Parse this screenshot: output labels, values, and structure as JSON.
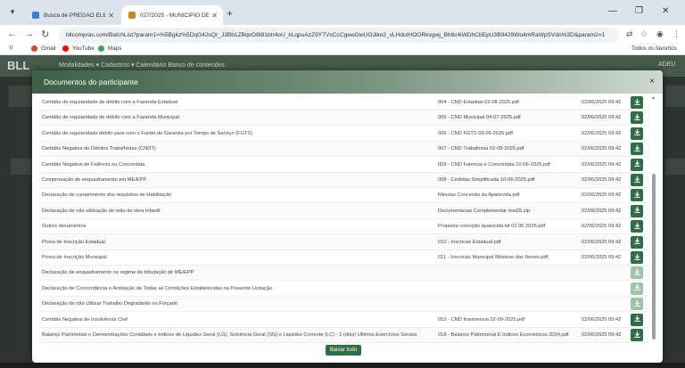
{
  "browser": {
    "tabs": [
      {
        "title": "Busca de PREGÃO ELETRÔNICO",
        "fav_color": "#3b7bd6"
      },
      {
        "title": "027/2025 - MUNICIPIO DE CO",
        "fav_color": "#c98a17"
      }
    ],
    "new_tab": "+",
    "url": "bllcompras.com/BatchList?param1=%5Bgkz%5DqG42sQr_J3Bb1ZBqvG6t81btr4oU_kLqpuAzZ9YTVxCcCgewGwUOJikn2_vLHdutHOORkvgwj_Bh8c4iWDhCbEpU3B9429Wo4mRaWpSVdo%3D&param2=1",
    "bookmarks": [
      {
        "label": "Gmail",
        "color": "#d44638"
      },
      {
        "label": "YouTube",
        "color": "#ff0000"
      },
      {
        "label": "Maps",
        "color": "#34a853"
      }
    ],
    "all_bookmarks": "Todos os favoritos"
  },
  "background": {
    "logo": "BLL",
    "menu": "Modalidades ▾   Cadastros ▾   Calendário   Banco de conteúdos",
    "right_text": "ADEU"
  },
  "modal": {
    "title": "Documentos do participante",
    "close": "×",
    "close_button": "Baixar todo",
    "rows": [
      {
        "name": "Certidão de regularidade de débito com a Fazenda Estadual",
        "file": "004 - CND Estadual 03-08-2025.pdf",
        "date": "02/06/2025 09:42",
        "enabled": true
      },
      {
        "name": "Certidão de regularidade de débito com a Fazenda Municipal",
        "file": "005 - CND Municipal 04-07-2025.pdf",
        "date": "02/06/2025 09:42",
        "enabled": true
      },
      {
        "name": "Certidão de regularidade débito para com o Fundo de Garantia por Tempo de Serviço (FGTS)",
        "file": "006 - CND FGTS 03-06-2025.pdf",
        "date": "02/06/2025 09:42",
        "enabled": true
      },
      {
        "name": "Certidão Negativa de Débitos Trabalhistas (CNDT)",
        "file": "007 - CND Trabalhista 02-08-2025.pdf",
        "date": "02/06/2025 09:42",
        "enabled": true
      },
      {
        "name": "Certidão Negativa de Falência ou Concordata",
        "file": "009 - CND Falencia e Concordata 10-06-2025.pdf",
        "date": "02/06/2025 09:42",
        "enabled": true
      },
      {
        "name": "Comprovação de enquadramento em ME/EPP",
        "file": "008 - Certidao Simplificada 10-06-2025.pdf",
        "date": "02/06/2025 09:42",
        "enabled": true
      },
      {
        "name": "Declaração de cumprimento dos requisitos de Habilitação",
        "file": "Minutas Concesão da Aparecida.pdf",
        "date": "02/06/2025 09:42",
        "enabled": true
      },
      {
        "name": "Declaração de não utilização de mão de obra infantil",
        "file": "Documentacao Complementar mai25.zip",
        "date": "02/08/2025 09:42",
        "enabled": true
      },
      {
        "name": "Outros documentos",
        "file": "Proposta concição aparecida kit 02 06 2025.pdf",
        "date": "02/06/2025 09:42",
        "enabled": true
      },
      {
        "name": "Prova de Inscrição Estadual",
        "file": "010 - Inscricao Estadual.pdf",
        "date": "02/06/2025 09:42",
        "enabled": true
      },
      {
        "name": "Prova de Inscrição Municipal",
        "file": "011 - Inscricao Municipal Ribeirao das Neves.pdf",
        "date": "02/06/2025 09:42",
        "enabled": true
      },
      {
        "name": "Declaração de enquadramento no regime de tributação de ME/EPP",
        "file": "",
        "date": "",
        "enabled": false
      },
      {
        "name": "Declaração de Concordância e Aceitação de Todas as Condições Estabelecidas na Presente Licitação",
        "file": "",
        "date": "",
        "enabled": false
      },
      {
        "name": "Declaração de não Utilizar Trabalho Degradante ou Forçado",
        "file": "",
        "date": "",
        "enabled": false
      },
      {
        "name": "Certidão Negativa de Insolvência Civil",
        "file": "015 - CND Insolvencia 02-09-2025.pdf",
        "date": "02/06/2025 09:42",
        "enabled": true
      },
      {
        "name": "Balanço Patrimonial e Demonstrações Contábeis e Índices de Liquidez Geral (LG), Solvência Geral (SG) e Liquidez Corrente (LC) - 2 (dois) Últimos Exercícios Sociais",
        "file": "018 - Balanco Patrimonial E Indices Economicos 2024.pdf",
        "date": "02/06/2025 09:42",
        "enabled": true
      }
    ]
  },
  "colors": {
    "accent": "#2e6f45",
    "accent_disabled": "#9fc2aa",
    "header_start": "#3d5e47"
  }
}
